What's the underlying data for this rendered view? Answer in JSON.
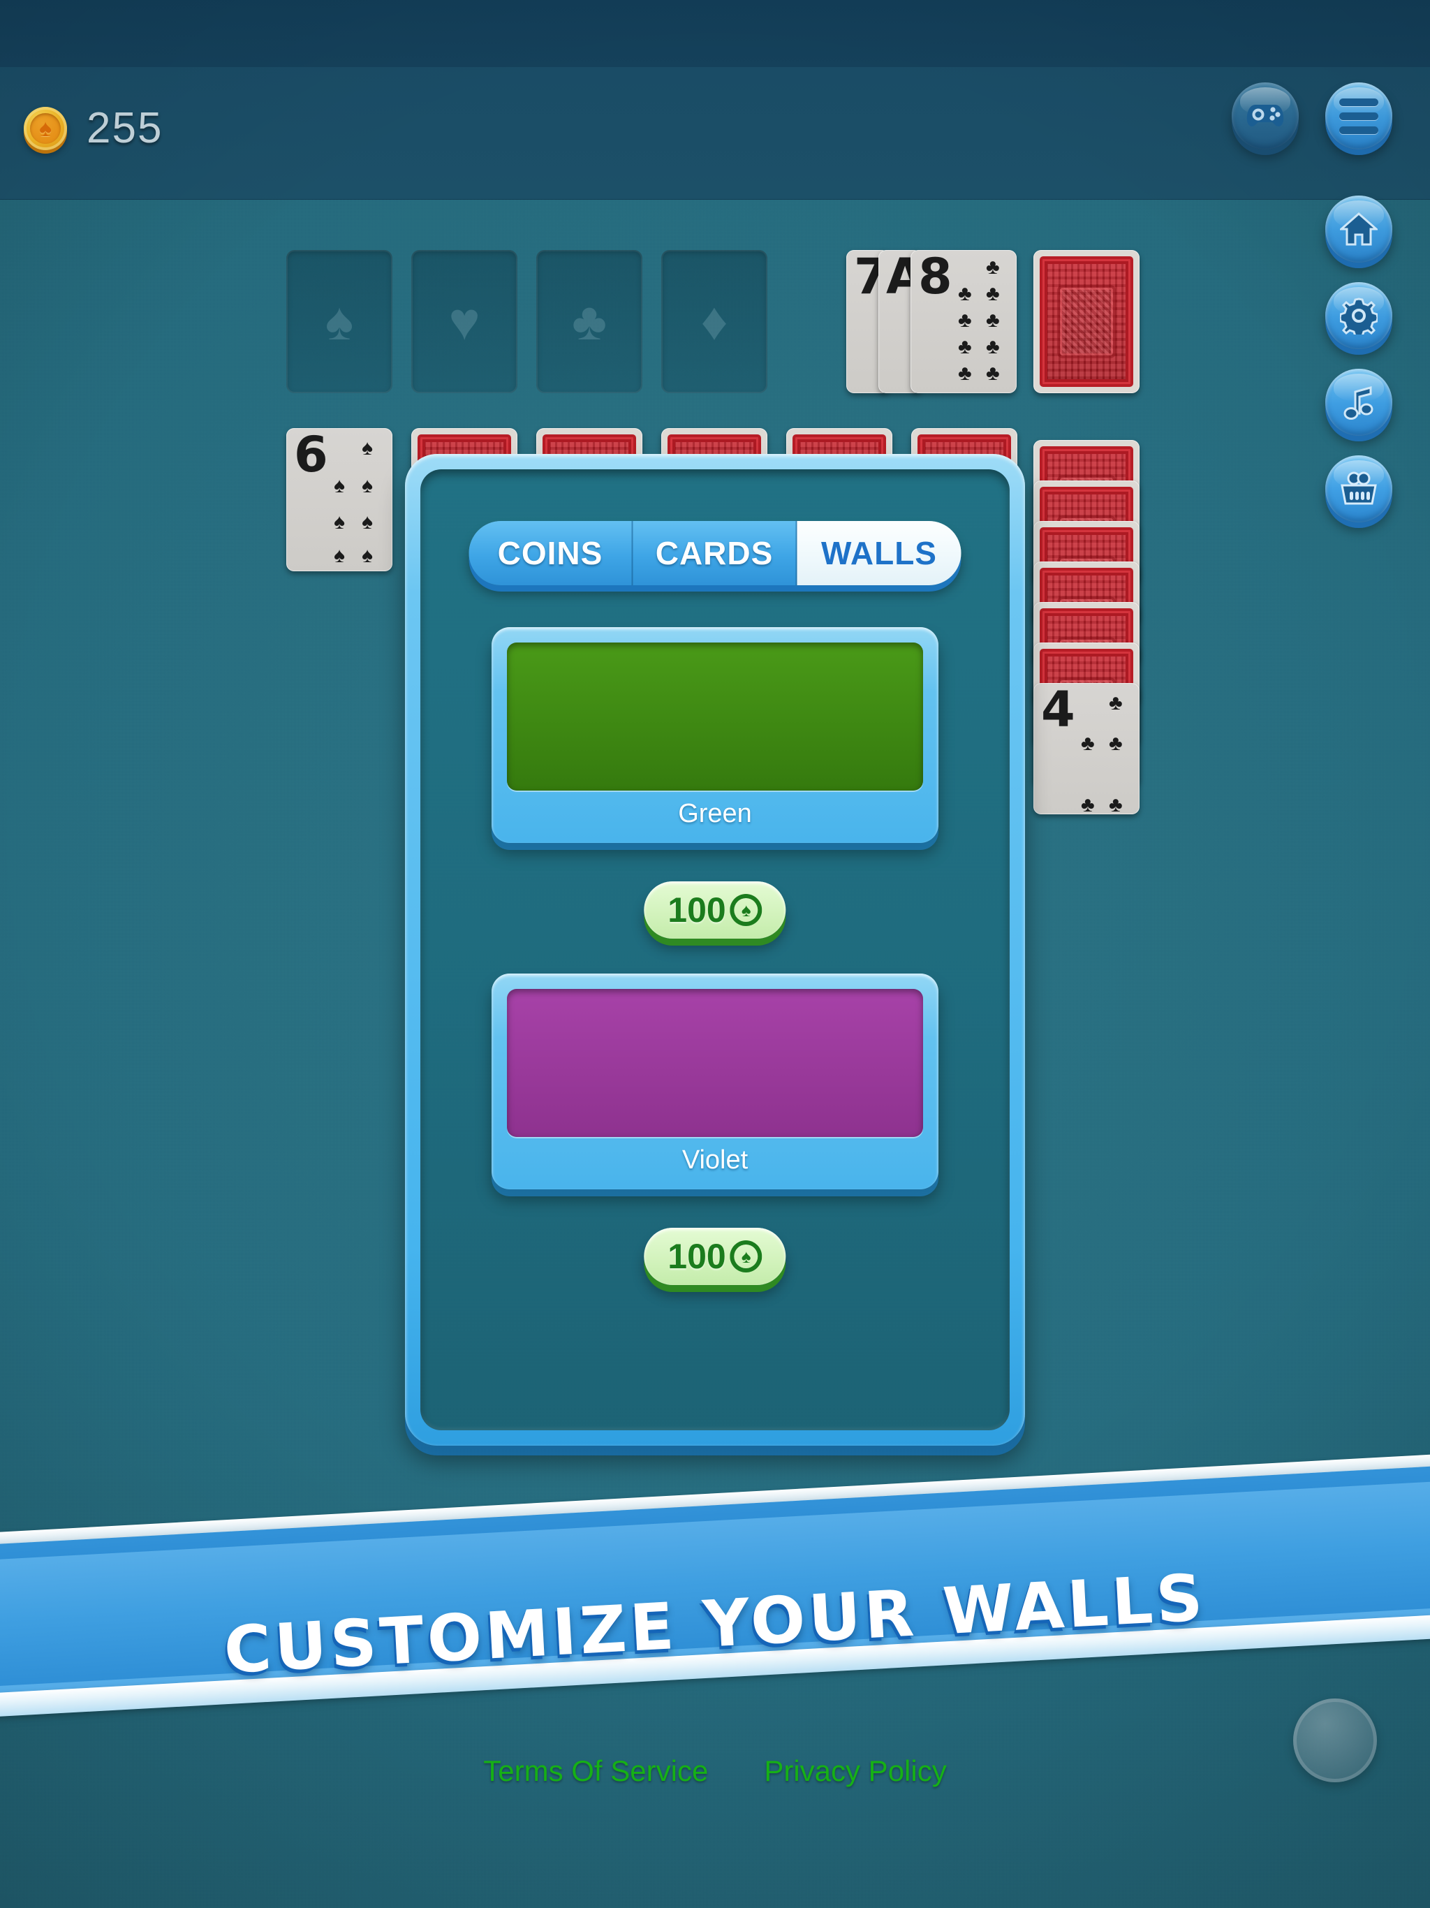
{
  "app": {
    "background_color": "#1d5b6c",
    "accent_color": "#3f9fe4"
  },
  "header": {
    "coin_icon": "spade-coin-icon",
    "coin_count": "255",
    "buttons": [
      {
        "name": "gamepad-button",
        "icon": "gamepad-icon",
        "state": "disabled"
      },
      {
        "name": "menu-button",
        "icon": "hamburger-menu-icon",
        "state": "enabled"
      }
    ]
  },
  "side_buttons": [
    {
      "name": "home-button",
      "icon": "home-icon",
      "glyph": "⌂"
    },
    {
      "name": "settings-button",
      "icon": "gear-icon",
      "glyph": "⚙"
    },
    {
      "name": "music-button",
      "icon": "music-note-icon",
      "glyph": "♫"
    },
    {
      "name": "shop-button",
      "icon": "shopping-basket-icon",
      "glyph": "⛁"
    }
  ],
  "table": {
    "foundations": [
      {
        "suit": "spade",
        "glyph": "♠"
      },
      {
        "suit": "heart",
        "glyph": "♥"
      },
      {
        "suit": "club",
        "glyph": "♣"
      },
      {
        "suit": "diamond",
        "glyph": "♦"
      }
    ],
    "waste_pile": [
      {
        "rank": "7",
        "suit_glyph": "♣",
        "color": "black"
      },
      {
        "rank": "A",
        "suit_glyph": "♣",
        "color": "black"
      },
      {
        "rank": "8",
        "suit_glyph": "♣",
        "color": "black",
        "pip_count": 9
      }
    ],
    "stock_card_back": "card-back-red",
    "left_card": {
      "rank": "6",
      "suit_glyph": "♠",
      "color": "black",
      "pip_count": 6
    },
    "right_column": {
      "face_down_count": 6,
      "face_up": {
        "rank": "4",
        "suit_glyph": "♣",
        "color": "black",
        "pip_count": 4
      }
    },
    "hidden_row_backs": 5
  },
  "shop_dialog": {
    "tabs": [
      {
        "label": "COINS",
        "active": false
      },
      {
        "label": "CARDS",
        "active": false
      },
      {
        "label": "WALLS",
        "active": true
      }
    ],
    "items": [
      {
        "label": "Green",
        "swatch_color": "#3d8a12",
        "swatch_gradient_top": "#4a9a18",
        "swatch_gradient_bottom": "#357a0e",
        "price": "100",
        "price_coin_icon": "spade-coin-icon"
      },
      {
        "label": "Violet",
        "swatch_color": "#9c3a9c",
        "swatch_gradient_top": "#a742a8",
        "swatch_gradient_bottom": "#8e328f",
        "price": "100",
        "price_coin_icon": "spade-coin-icon"
      }
    ]
  },
  "banner": {
    "headline": "CUSTOMIZE YOUR WALLS"
  },
  "footer": {
    "links": [
      {
        "label": "Terms Of Service"
      },
      {
        "label": "Privacy Policy"
      }
    ]
  }
}
